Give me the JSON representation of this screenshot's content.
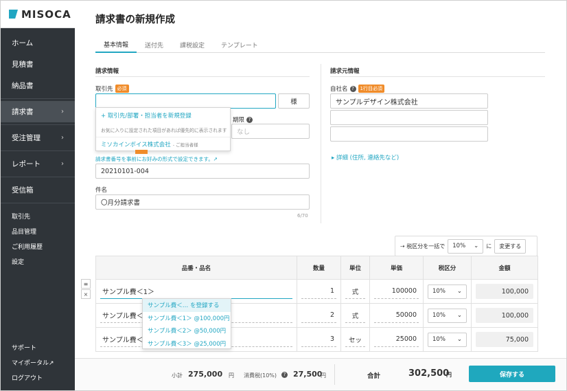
{
  "sidebar": {
    "logo": "MISOCA",
    "nav": [
      {
        "label": "ホーム"
      },
      {
        "label": "見積書"
      },
      {
        "label": "納品書"
      },
      {
        "label": "請求書",
        "chevron": "›"
      },
      {
        "label": "受注管理",
        "chevron": "›"
      },
      {
        "label": "レポート",
        "chevron": "›"
      },
      {
        "label": "受信箱"
      }
    ],
    "sub": [
      {
        "label": "取引先"
      },
      {
        "label": "品目管理"
      },
      {
        "label": "ご利用履歴"
      },
      {
        "label": "設定"
      }
    ],
    "bottom": [
      {
        "label": "サポート"
      },
      {
        "label": "マイポータル↗"
      },
      {
        "label": "ログアウト"
      }
    ]
  },
  "page": {
    "title": "請求書の新規作成",
    "tabs": [
      "基本情報",
      "送付先",
      "課税設定",
      "テンプレート"
    ]
  },
  "billing": {
    "section": "請求情報",
    "client_label": "取引先",
    "required": "必須",
    "client_value": "",
    "honorific": "様",
    "dropdown": {
      "add": "+ 取引先/部署・担当者を新規登録",
      "note": "お気に入りに設定された項目があれば優先的に表示されます",
      "item": "ミソカインボイス株式会社",
      "item_note": "- ご担当者様"
    },
    "due_label": "期限",
    "due_placeholder": "なし",
    "number_hint": "請求書番号を事前にお好みの形式で設定できます。↗",
    "number_value": "20210101-004",
    "subject_label": "件名",
    "subject_value": "〇月分請求書",
    "subject_count": "6/70"
  },
  "issuer": {
    "section": "請求元情報",
    "company_label": "自社名",
    "required": "1行目必須",
    "line1": "サンプルデザイン株式会社",
    "line2": "",
    "line3": "",
    "details_link": "▸ 詳細 (住所, 連絡先など)"
  },
  "bulk": {
    "label": "⇢ 税区分を一括で",
    "value": "10%",
    "suffix": "に",
    "button": "変更する"
  },
  "table": {
    "headers": [
      "品番・品名",
      "数量",
      "単位",
      "単価",
      "税区分",
      "金額"
    ],
    "rows": [
      {
        "name": "サンプル費＜1＞",
        "qty": "1",
        "unit": "式",
        "price": "100000",
        "tax": "10%",
        "amount": "100,000"
      },
      {
        "name": "サンプル費＜",
        "qty": "2",
        "unit": "式",
        "price": "50000",
        "tax": "10%",
        "amount": "100,000"
      },
      {
        "name": "サンプル費＜",
        "qty": "3",
        "unit": "セッ",
        "price": "25000",
        "tax": "10%",
        "amount": "75,000"
      }
    ],
    "suggest": [
      "サンプル費＜… を登録する",
      "サンプル費＜1＞ @100,000円",
      "サンプル費＜2＞ @50,000円",
      "サンプル費＜3＞ @25,000円"
    ]
  },
  "footer": {
    "subtotal_label": "小計",
    "subtotal": "275,000",
    "tax_label": "消費税(10%)",
    "tax": "27,500",
    "yen": "円",
    "total_label": "合計",
    "total": "302,500",
    "save": "保存する"
  }
}
